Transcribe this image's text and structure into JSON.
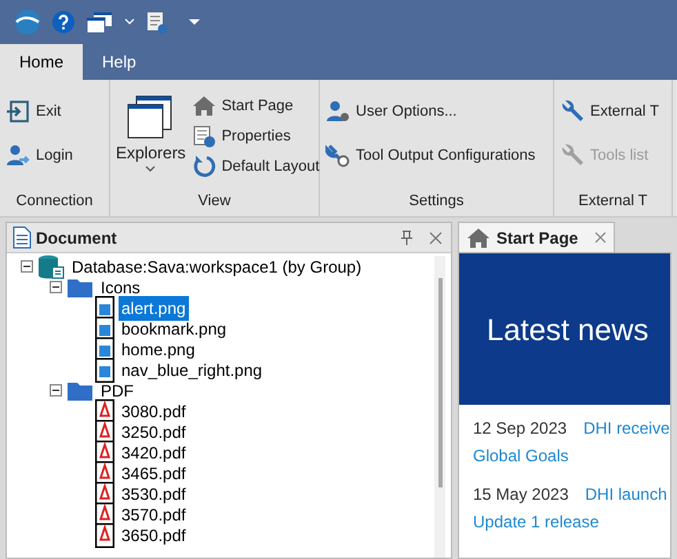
{
  "ribbon_tabs": [
    {
      "label": "Home",
      "selected": true
    },
    {
      "label": "Help",
      "selected": false
    }
  ],
  "ribbon_groups": [
    {
      "label": "Connection",
      "kind": "stack",
      "items": [
        {
          "label": "Exit",
          "disabled": false
        },
        {
          "label": "Login",
          "disabled": false
        }
      ]
    },
    {
      "label": "View",
      "kind": "large",
      "large": {
        "label": "Explorers"
      },
      "items": [
        {
          "label": "Start Page",
          "disabled": false
        },
        {
          "label": "Properties",
          "disabled": false
        },
        {
          "label": "Default Layout",
          "disabled": false
        }
      ]
    },
    {
      "label": "Settings",
      "kind": "stack",
      "items": [
        {
          "label": "User Options...",
          "disabled": false
        },
        {
          "label": "Tool Output Configurations",
          "disabled": false
        }
      ]
    },
    {
      "label": "External T",
      "kind": "stack",
      "items": [
        {
          "label": "External T",
          "disabled": false
        },
        {
          "label": "Tools list",
          "disabled": true
        }
      ]
    }
  ],
  "document_panel": {
    "title": "Document",
    "tree": [
      {
        "label": "Database:Sava:workspace1 (by Group)",
        "kind": "database",
        "expanded": true,
        "selected": false,
        "children": [
          {
            "label": "Icons",
            "kind": "folder",
            "expanded": true,
            "selected": false,
            "children": [
              {
                "label": "alert.png",
                "kind": "image",
                "selected": true
              },
              {
                "label": "bookmark.png",
                "kind": "image",
                "selected": false
              },
              {
                "label": "home.png",
                "kind": "image",
                "selected": false
              },
              {
                "label": "nav_blue_right.png",
                "kind": "image",
                "selected": false
              }
            ]
          },
          {
            "label": "PDF",
            "kind": "folder",
            "expanded": true,
            "selected": false,
            "children": [
              {
                "label": "3080.pdf",
                "kind": "pdf",
                "selected": false
              },
              {
                "label": "3250.pdf",
                "kind": "pdf",
                "selected": false
              },
              {
                "label": "3420.pdf",
                "kind": "pdf",
                "selected": false
              },
              {
                "label": "3465.pdf",
                "kind": "pdf",
                "selected": false
              },
              {
                "label": "3530.pdf",
                "kind": "pdf",
                "selected": false
              },
              {
                "label": "3570.pdf",
                "kind": "pdf",
                "selected": false
              },
              {
                "label": "3650.pdf",
                "kind": "pdf",
                "selected": false
              }
            ]
          }
        ]
      }
    ]
  },
  "start_page": {
    "tab": "Start Page",
    "banner": "Latest news",
    "news": [
      {
        "date": "12 Sep 2023",
        "lines": [
          "DHI receive",
          "Global Goals"
        ]
      },
      {
        "date": "15 May 2023",
        "lines": [
          "DHI launch",
          "Update 1 release"
        ]
      }
    ]
  }
}
